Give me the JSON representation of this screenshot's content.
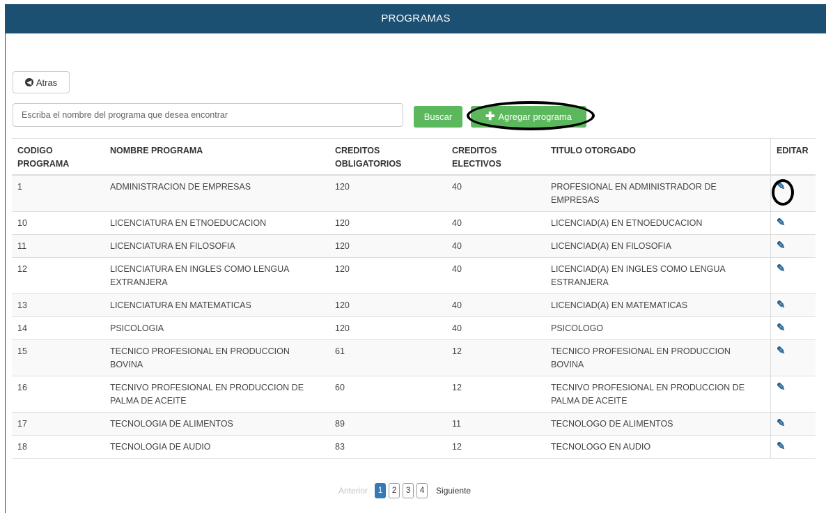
{
  "header": {
    "title": "PROGRAMAS"
  },
  "toolbar": {
    "back_label": "Atras",
    "search_placeholder": "Escriba el nombre del programa que desea encontrar",
    "search_value": "",
    "search_button": "Buscar",
    "add_button": "Agregar programa"
  },
  "table": {
    "headers": {
      "codigo": "CODIGO PROGRAMA",
      "nombre": "NOMBRE PROGRAMA",
      "obligatorios": "CREDITOS OBLIGATORIOS",
      "electivos": "CREDITOS ELECTIVOS",
      "titulo": "TITULO OTORGADO",
      "editar": "EDITAR"
    },
    "rows": [
      {
        "codigo": "1",
        "nombre": "ADMINISTRACION DE EMPRESAS",
        "obligatorios": "120",
        "electivos": "40",
        "titulo": "PROFESIONAL EN ADMINISTRADOR DE EMPRESAS"
      },
      {
        "codigo": "10",
        "nombre": "LICENCIATURA EN ETNOEDUCACION",
        "obligatorios": "120",
        "electivos": "40",
        "titulo": "LICENCIAD(A) EN ETNOEDUCACION"
      },
      {
        "codigo": "11",
        "nombre": "LICENCIATURA EN FILOSOFIA",
        "obligatorios": "120",
        "electivos": "40",
        "titulo": "LICENCIAD(A) EN FILOSOFIA"
      },
      {
        "codigo": "12",
        "nombre": "LICENCIATURA EN INGLES COMO LENGUA EXTRANJERA",
        "obligatorios": "120",
        "electivos": "40",
        "titulo": "LICENCIAD(A) EN INGLES COMO LENGUA ESTRANJERA"
      },
      {
        "codigo": "13",
        "nombre": "LICENCIATURA EN MATEMATICAS",
        "obligatorios": "120",
        "electivos": "40",
        "titulo": "LICENCIAD(A) EN MATEMATICAS"
      },
      {
        "codigo": "14",
        "nombre": "PSICOLOGIA",
        "obligatorios": "120",
        "electivos": "40",
        "titulo": "PSICOLOGO"
      },
      {
        "codigo": "15",
        "nombre": "TECNICO PROFESIONAL EN PRODUCCION BOVINA",
        "obligatorios": "61",
        "electivos": "12",
        "titulo": "TECNICO PROFESIONAL EN PRODUCCION BOVINA"
      },
      {
        "codigo": "16",
        "nombre": "TECNIVO PROFESIONAL EN PRODUCCION DE PALMA DE ACEITE",
        "obligatorios": "60",
        "electivos": "12",
        "titulo": "TECNIVO PROFESIONAL EN PRODUCCION DE PALMA DE ACEITE"
      },
      {
        "codigo": "17",
        "nombre": "TECNOLOGIA DE ALIMENTOS",
        "obligatorios": "89",
        "electivos": "11",
        "titulo": "TECNOLOGO DE ALIMENTOS"
      },
      {
        "codigo": "18",
        "nombre": "TECNOLOGIA DE AUDIO",
        "obligatorios": "83",
        "electivos": "12",
        "titulo": "TECNOLOGO EN AUDIO"
      }
    ]
  },
  "pagination": {
    "prev": "Anterior",
    "pages": [
      "1",
      "2",
      "3",
      "4"
    ],
    "active_page": "1",
    "next": "Siguiente"
  },
  "icons": {
    "back": "circle-arrow-left-icon",
    "add": "plus-icon",
    "edit": "edit-square-icon"
  },
  "colors": {
    "header": "#1b5073",
    "success": "#5cb85c",
    "primary": "#337ab7",
    "edit_icon": "#1f5f8f"
  }
}
